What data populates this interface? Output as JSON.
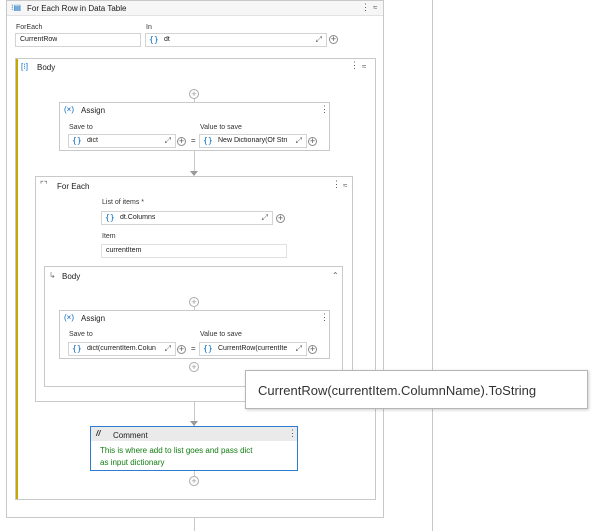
{
  "foreach_row": {
    "title": "For Each Row in Data Table",
    "foreach_label": "ForEach",
    "foreach_value": "CurrentRow",
    "in_label": "In",
    "in_value": "dt"
  },
  "outer_body": {
    "title": "Body"
  },
  "assign1": {
    "title": "Assign",
    "save_to_label": "Save to",
    "save_to_value": "dict",
    "value_label": "Value to save",
    "value_value": "New Dictionary(Of Stri"
  },
  "foreach": {
    "title": "For Each",
    "list_label": "List of items *",
    "list_value": "dt.Columns",
    "item_label": "Item",
    "item_value": "currentItem"
  },
  "inner_body": {
    "title": "Body"
  },
  "assign2": {
    "title": "Assign",
    "save_to_label": "Save to",
    "save_to_value": "dict(currentItem.Colun",
    "value_label": "Value to save",
    "value_value": "CurrentRow(currentIte"
  },
  "tooltip": {
    "text": "CurrentRow(currentItem.ColumnName).ToString"
  },
  "comment": {
    "title": "Comment",
    "text_line1": "This is where add to list goes and pass dict",
    "text_line2": "as input dictionary"
  },
  "glyphs": {
    "brace": "{}",
    "equals": "=",
    "plus": "+",
    "kebab": "⋮",
    "collapse": "≈",
    "expand": "⤢",
    "chevron_up": "⌃",
    "comment": "//"
  },
  "colors": {
    "accent": "#0067c0",
    "selection": "#2f7bd1",
    "comment_text": "#107c10",
    "body_bar": "#c7a800"
  }
}
